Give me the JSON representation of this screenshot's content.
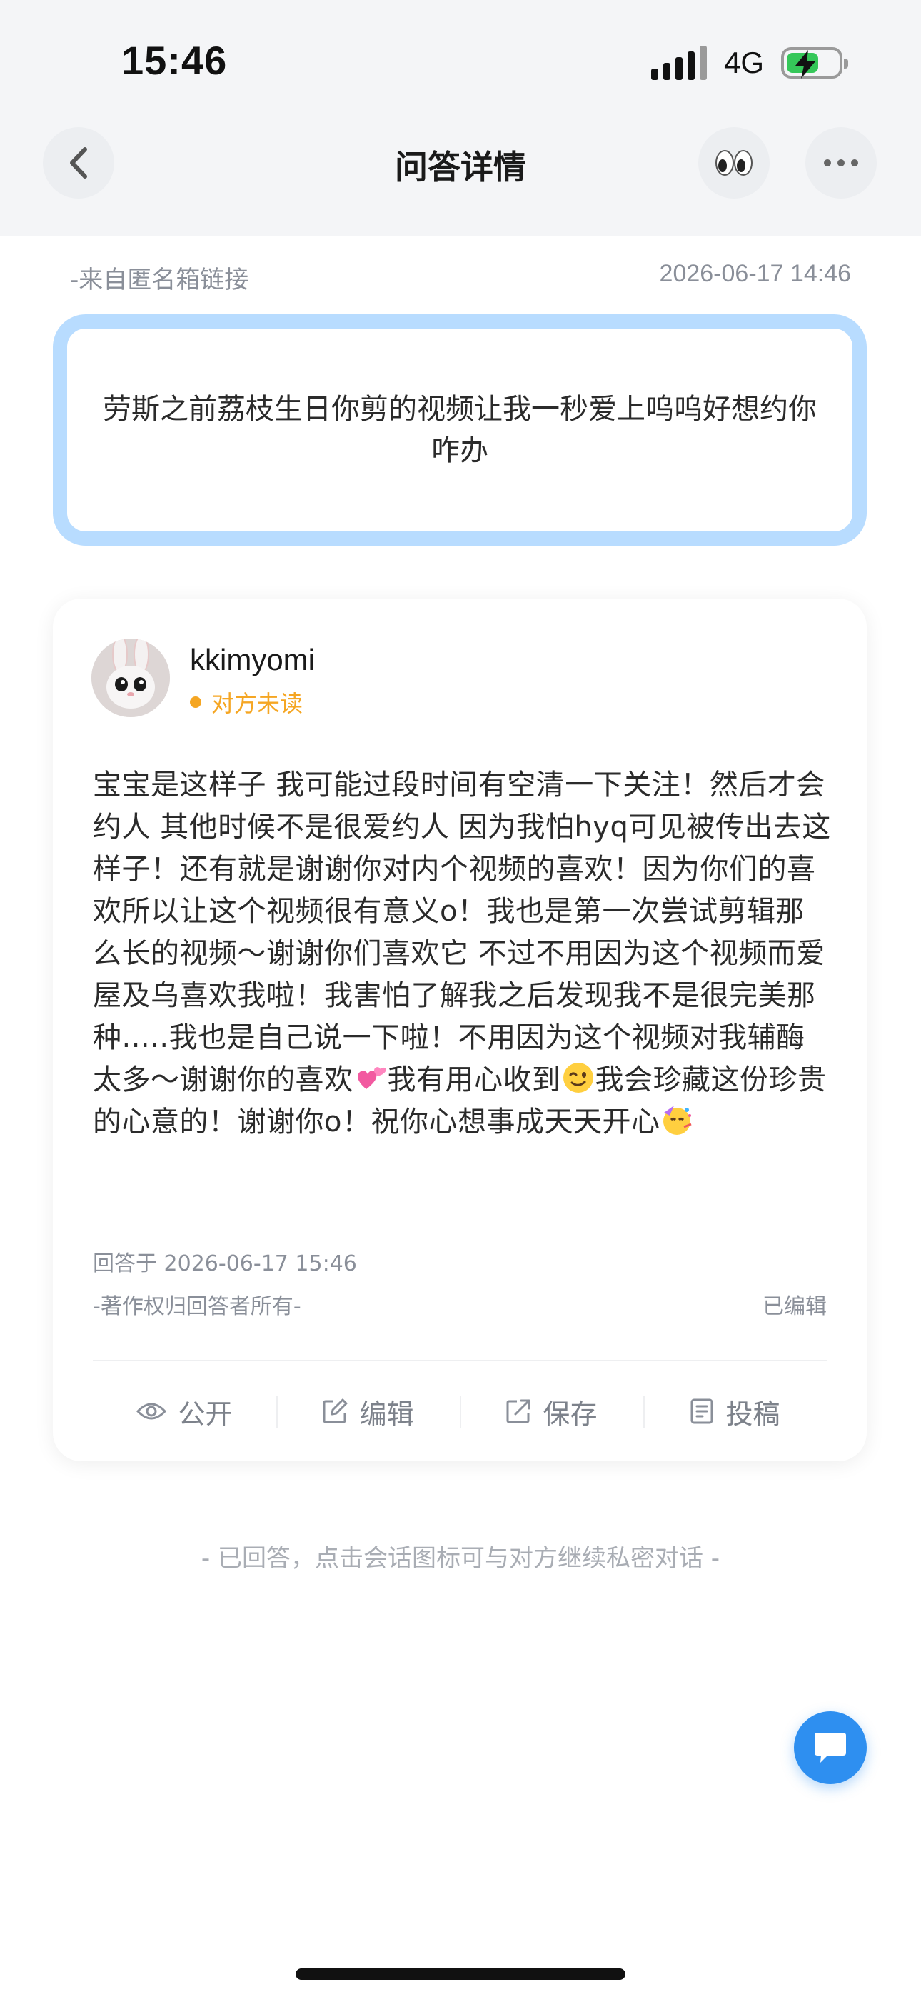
{
  "status_bar": {
    "time": "15:46",
    "network": "4G",
    "battery_level": 0.55,
    "battery_color": "#35c759"
  },
  "nav": {
    "title": "问答详情",
    "back_icon": "chevron-left-icon",
    "eyes_icon": "eyes-emoji-icon",
    "more_icon": "more-dots-icon"
  },
  "question": {
    "source": "-来自匿名箱链接",
    "date": "2026-06-17 14:46",
    "text": "劳斯之前荔枝生日你剪的视频让我一秒爱上呜呜好想约你咋办",
    "border_color": "#b8dcff"
  },
  "answer": {
    "username": "kkimyomi",
    "read_status": "对方未读",
    "read_status_color": "#f5a623",
    "text_part1": "宝宝是这样子 我可能过段时间有空清一下关注！然后才会约人 其他时候不是很爱约人 因为我怕hyq可见被传出去这样子！还有就是谢谢你对内个视频的喜欢！因为你们的喜欢所以让这个视频很有意义o！我也是第一次尝试剪辑那么长的视频～谢谢你们喜欢它 不过不用因为这个视频而爱屋及乌喜欢我啦！我害怕了解我之后发现我不是很完美那种.....我也是自己说一下啦！不用因为这个视频对我辅酶太多～谢谢你的喜欢",
    "text_part2": "我有用心收到",
    "text_part3": "我会珍藏这份珍贵的心意的！谢谢你o！祝你心想事成天天开心",
    "answered_at": "回答于 2026-06-17 15:46",
    "copyright": "-著作权归回答者所有-",
    "edited": "已编辑"
  },
  "actions": [
    {
      "label": "公开",
      "icon": "eye-icon"
    },
    {
      "label": "编辑",
      "icon": "edit-icon"
    },
    {
      "label": "保存",
      "icon": "share-out-icon"
    },
    {
      "label": "投稿",
      "icon": "document-icon"
    }
  ],
  "footer_note": "- 已回答，点击会话图标可与对方继续私密对话 -",
  "fab": {
    "icon": "chat-bubble-icon",
    "color": "#2e8ff0"
  }
}
